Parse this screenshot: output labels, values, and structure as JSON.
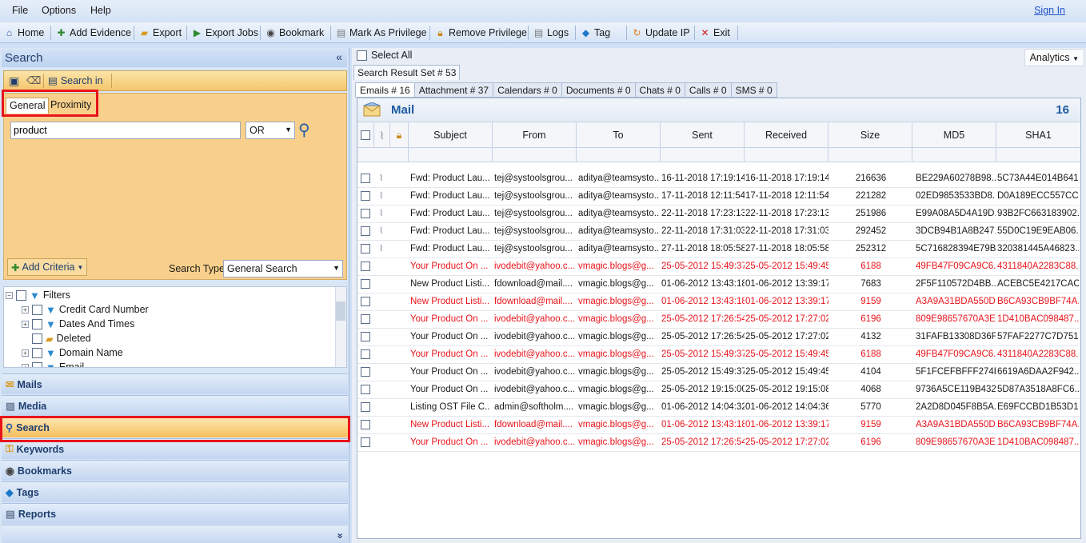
{
  "menu": {
    "items": [
      "File",
      "Options",
      "Help"
    ],
    "sign_in": "Sign In"
  },
  "toolbar": {
    "home": "Home",
    "add_evidence": "Add Evidence",
    "export": "Export",
    "export_jobs": "Export Jobs",
    "bookmark": "Bookmark",
    "mark_privilege": "Mark As Privilege",
    "remove_privilege": "Remove Privilege",
    "logs": "Logs",
    "tag": "Tag",
    "update_ip": "Update IP",
    "exit": "Exit"
  },
  "left": {
    "title": "Search",
    "collapse": "«",
    "search_in": "Search in",
    "tabs": {
      "general": "General",
      "proximity": "Proximity"
    },
    "query": "product",
    "operator": "OR",
    "add_criteria": "Add Criteria",
    "search_type_label": "Search Type",
    "search_type": "General Search",
    "tree": {
      "root": "Filters",
      "items": [
        "Credit Card Number",
        "Dates And Times",
        "Deleted",
        "Domain Name",
        "Email"
      ]
    },
    "nav": [
      "Mails",
      "Media",
      "Search",
      "Keywords",
      "Bookmarks",
      "Tags",
      "Reports"
    ],
    "more": "»"
  },
  "right": {
    "select_all": "Select All",
    "analytics": "Analytics",
    "result_set": "Search Result Set # 53",
    "subtabs": [
      "Emails # 16",
      "Attachment # 37",
      "Calendars # 0",
      "Documents # 0",
      "Chats # 0",
      "Calls # 0",
      "SMS # 0"
    ],
    "grid": {
      "title": "Mail",
      "count": "16",
      "columns": [
        "Subject",
        "From",
        "To",
        "Sent",
        "Received",
        "Size",
        "MD5",
        "SHA1"
      ],
      "rows": [
        {
          "red": false,
          "clip": true,
          "subject": "Fwd: Product Lau...",
          "from": "tej@systoolsgrou...",
          "to": "aditya@teamsysto...",
          "sent": "16-11-2018 17:19:14",
          "received": "16-11-2018 17:19:14",
          "size": "216636",
          "md5": "BE229A60278B98...",
          "sha1": "5C73A44E014B641..."
        },
        {
          "red": false,
          "clip": true,
          "subject": "Fwd: Product Lau...",
          "from": "tej@systoolsgrou...",
          "to": "aditya@teamsysto...",
          "sent": "17-11-2018 12:11:54",
          "received": "17-11-2018 12:11:54",
          "size": "221282",
          "md5": "02ED9853533BD8...",
          "sha1": "D0A189ECC557CC..."
        },
        {
          "red": false,
          "clip": true,
          "subject": "Fwd: Product Lau...",
          "from": "tej@systoolsgrou...",
          "to": "aditya@teamsysto...",
          "sent": "22-11-2018 17:23:13",
          "received": "22-11-2018 17:23:13",
          "size": "251986",
          "md5": "E99A08A5D4A19D...",
          "sha1": "93B2FC663183902..."
        },
        {
          "red": false,
          "clip": true,
          "subject": "Fwd: Product Lau...",
          "from": "tej@systoolsgrou...",
          "to": "aditya@teamsysto...",
          "sent": "22-11-2018 17:31:03",
          "received": "22-11-2018 17:31:03",
          "size": "292452",
          "md5": "3DCB94B1A8B247...",
          "sha1": "55D0C19E9EAB06..."
        },
        {
          "red": false,
          "clip": true,
          "subject": "Fwd: Product Lau...",
          "from": "tej@systoolsgrou...",
          "to": "aditya@teamsysto...",
          "sent": "27-11-2018 18:05:58",
          "received": "27-11-2018 18:05:58",
          "size": "252312",
          "md5": "5C716828394E79B...",
          "sha1": "320381445A46823..."
        },
        {
          "red": true,
          "clip": false,
          "subject": "Your Product On ...",
          "from": "ivodebit@yahoo.c...",
          "to": "vmagic.blogs@g...",
          "sent": "25-05-2012 15:49:37",
          "received": "25-05-2012 15:49:45",
          "size": "6188",
          "md5": "49FB47F09CA9C6...",
          "sha1": "4311840A2283C88..."
        },
        {
          "red": false,
          "clip": false,
          "subject": "New Product Listi...",
          "from": "fdownload@mail....",
          "to": "vmagic.blogs@g...",
          "sent": "01-06-2012 13:43:18",
          "received": "01-06-2012 13:39:17",
          "size": "7683",
          "md5": "2F5F110572D4BB...",
          "sha1": "ACEBC5E4217CAC..."
        },
        {
          "red": true,
          "clip": false,
          "subject": "New Product Listi...",
          "from": "fdownload@mail....",
          "to": "vmagic.blogs@g...",
          "sent": "01-06-2012 13:43:18",
          "received": "01-06-2012 13:39:17",
          "size": "9159",
          "md5": "A3A9A31BDA550D...",
          "sha1": "B6CA93CB9BF74A..."
        },
        {
          "red": true,
          "clip": false,
          "subject": "Your Product On ...",
          "from": "ivodebit@yahoo.c...",
          "to": "vmagic.blogs@g...",
          "sent": "25-05-2012 17:26:54",
          "received": "25-05-2012 17:27:02",
          "size": "6196",
          "md5": "809E98657670A3E...",
          "sha1": "1D410BAC098487..."
        },
        {
          "red": false,
          "clip": false,
          "subject": "Your Product On ...",
          "from": "ivodebit@yahoo.c...",
          "to": "vmagic.blogs@g...",
          "sent": "25-05-2012 17:26:54",
          "received": "25-05-2012 17:27:02",
          "size": "4132",
          "md5": "31FAFB13308D36F...",
          "sha1": "57FAF2277C7D751..."
        },
        {
          "red": true,
          "clip": false,
          "subject": "Your Product On ...",
          "from": "ivodebit@yahoo.c...",
          "to": "vmagic.blogs@g...",
          "sent": "25-05-2012 15:49:37",
          "received": "25-05-2012 15:49:45",
          "size": "6188",
          "md5": "49FB47F09CA9C6...",
          "sha1": "4311840A2283C88..."
        },
        {
          "red": false,
          "clip": false,
          "subject": "Your Product On ...",
          "from": "ivodebit@yahoo.c...",
          "to": "vmagic.blogs@g...",
          "sent": "25-05-2012 15:49:37",
          "received": "25-05-2012 15:49:45",
          "size": "4104",
          "md5": "5F1FCEFBFFF274B...",
          "sha1": "6619A6DAA2F942..."
        },
        {
          "red": false,
          "clip": false,
          "subject": "Your Product On ...",
          "from": "ivodebit@yahoo.c...",
          "to": "vmagic.blogs@g...",
          "sent": "25-05-2012 19:15:00",
          "received": "25-05-2012 19:15:08",
          "size": "4068",
          "md5": "9736A5CE119B432...",
          "sha1": "5D87A3518A8FC6..."
        },
        {
          "red": false,
          "clip": false,
          "subject": "Listing OST File C...",
          "from": "admin@softholm....",
          "to": "vmagic.blogs@g...",
          "sent": "01-06-2012 14:04:32",
          "received": "01-06-2012 14:04:36",
          "size": "5770",
          "md5": "2A2D8D045F8B5A...",
          "sha1": "E69FCCBD1B53D1..."
        },
        {
          "red": true,
          "clip": false,
          "subject": "New Product Listi...",
          "from": "fdownload@mail....",
          "to": "vmagic.blogs@g...",
          "sent": "01-06-2012 13:43:18",
          "received": "01-06-2012 13:39:17",
          "size": "9159",
          "md5": "A3A9A31BDA550D...",
          "sha1": "B6CA93CB9BF74A..."
        },
        {
          "red": true,
          "clip": false,
          "subject": "Your Product On ...",
          "from": "ivodebit@yahoo.c...",
          "to": "vmagic.blogs@g...",
          "sent": "25-05-2012 17:26:54",
          "received": "25-05-2012 17:27:02",
          "size": "6196",
          "md5": "809E98657670A3E...",
          "sha1": "1D410BAC098487..."
        }
      ]
    }
  }
}
